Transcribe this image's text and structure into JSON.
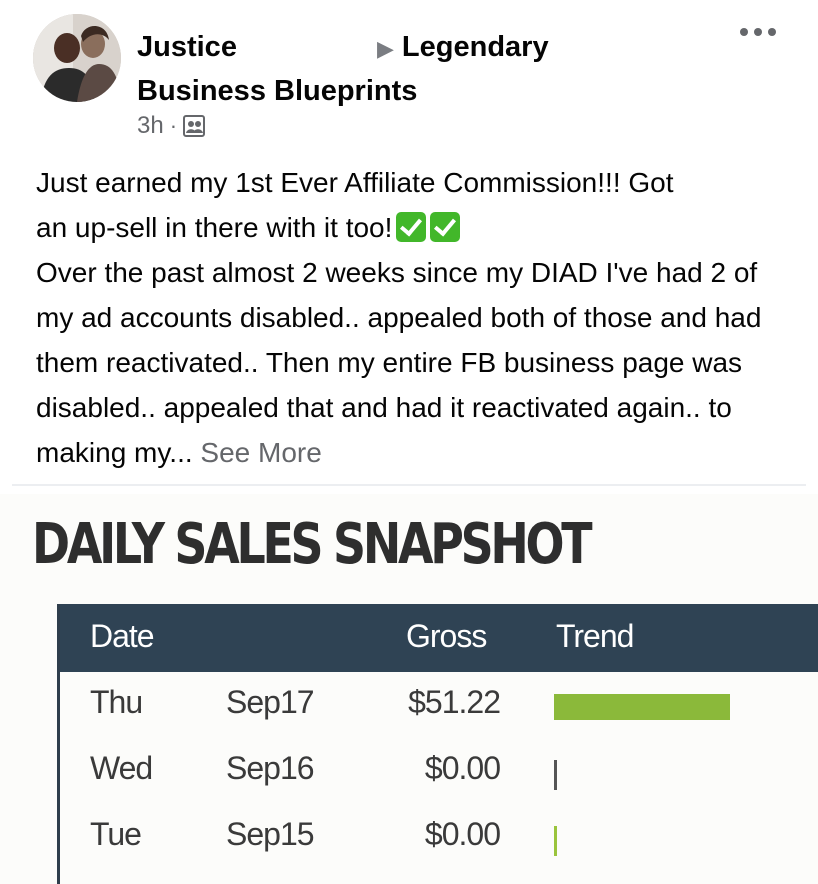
{
  "post": {
    "author_name": "Justice",
    "group_arrow": "▶",
    "group_name": "Legendary Business Blueprints",
    "group_name_line1": "Legendary",
    "group_name_line2": "Business Blueprints",
    "time": "3h",
    "separator": "·",
    "audience_icon": "group-icon",
    "more_icon": "more-options-icon",
    "text_line1": "Just earned my 1st Ever Affiliate Commission!!! Got",
    "text_line2": "an up-sell in there with it too!",
    "emoji": [
      "check-mark-button",
      "check-mark-button"
    ],
    "text_body": "Over the past almost 2 weeks since my DIAD I've had 2 of my ad accounts disabled.. appealed both of those and had them reactivated.. Then my entire FB business page was disabled.. appealed that and had it reactivated again.. to making my...",
    "see_more": "See More"
  },
  "snapshot": {
    "title": "DAILY SALES SNAPSHOT",
    "headers": {
      "date": "Date",
      "gross": "Gross",
      "trend": "Trend"
    },
    "rows": [
      {
        "day": "Thu",
        "date": "Sep17",
        "gross": "$51.22",
        "trend_fraction": 1.0
      },
      {
        "day": "Wed",
        "date": "Sep16",
        "gross": "$0.00",
        "trend_fraction": 0.0
      },
      {
        "day": "Tue",
        "date": "Sep15",
        "gross": "$0.00",
        "trend_fraction": 0.0
      }
    ],
    "colors": {
      "header_bg": "#2f4354",
      "trend_bar": "#8bb93a",
      "tick_dark": "#555555",
      "tick_green": "#9ac43c"
    }
  }
}
